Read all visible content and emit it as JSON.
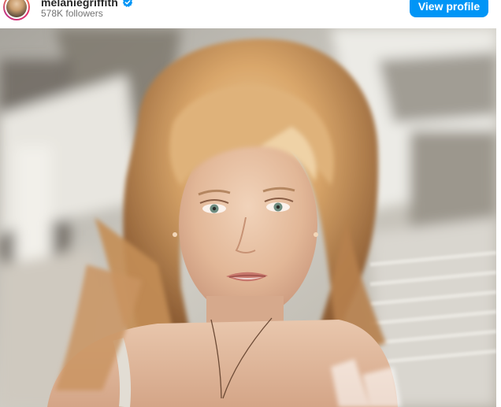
{
  "post": {
    "username": "melaniegriffith",
    "verified": true,
    "followers": "578K followers",
    "view_profile_label": "View profile"
  },
  "icons": {
    "avatar": "profile-avatar",
    "verified": "verified-badge-icon"
  },
  "colors": {
    "button": "#0095f6",
    "button_text": "#ffffff",
    "username": "#262626",
    "followers": "#737373",
    "verified": "#0095f6",
    "avatar_ring": "#e1306c"
  }
}
